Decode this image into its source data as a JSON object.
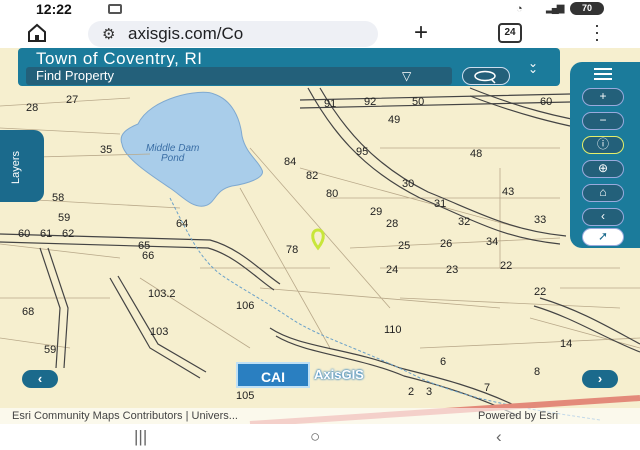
{
  "status_bar": {
    "time": "12:22",
    "battery": "70"
  },
  "browser": {
    "url": "axisgis.com/Co",
    "tab_count": "24"
  },
  "map_header": {
    "title": "Town of Coventry, RI",
    "find_label": "Find Property"
  },
  "layers_label": "Layers",
  "map": {
    "pond_name_1": "Middle Dam",
    "pond_name_2": "Pond",
    "parcels": [
      {
        "id": "p28",
        "t": "28"
      },
      {
        "id": "p27",
        "t": "27"
      },
      {
        "id": "p35",
        "t": "35"
      },
      {
        "id": "p58",
        "t": "58"
      },
      {
        "id": "p59",
        "t": "59"
      },
      {
        "id": "p60",
        "t": "60"
      },
      {
        "id": "p61",
        "t": "61"
      },
      {
        "id": "p62",
        "t": "62"
      },
      {
        "id": "p65",
        "t": "65"
      },
      {
        "id": "p66",
        "t": "66"
      },
      {
        "id": "p64",
        "t": "64"
      },
      {
        "id": "p84",
        "t": "84"
      },
      {
        "id": "p82",
        "t": "82"
      },
      {
        "id": "p80",
        "t": "80"
      },
      {
        "id": "p78",
        "t": "78"
      },
      {
        "id": "p91",
        "t": "91"
      },
      {
        "id": "p92",
        "t": "92"
      },
      {
        "id": "p50",
        "t": "50"
      },
      {
        "id": "p49",
        "t": "49"
      },
      {
        "id": "p95",
        "t": "95"
      },
      {
        "id": "p48",
        "t": "48"
      },
      {
        "id": "p30",
        "t": "30"
      },
      {
        "id": "p43",
        "t": "43"
      },
      {
        "id": "p31",
        "t": "31"
      },
      {
        "id": "p29",
        "t": "29"
      },
      {
        "id": "p28b",
        "t": "28"
      },
      {
        "id": "p32",
        "t": "32"
      },
      {
        "id": "p33",
        "t": "33"
      },
      {
        "id": "p25",
        "t": "25"
      },
      {
        "id": "p26",
        "t": "26"
      },
      {
        "id": "p34",
        "t": "34"
      },
      {
        "id": "p24",
        "t": "24"
      },
      {
        "id": "p23",
        "t": "23"
      },
      {
        "id": "p22",
        "t": "22"
      },
      {
        "id": "p22b",
        "t": "22"
      },
      {
        "id": "p60b",
        "t": "60"
      },
      {
        "id": "p1032",
        "t": "103.2"
      },
      {
        "id": "p106",
        "t": "106"
      },
      {
        "id": "p68",
        "t": "68"
      },
      {
        "id": "p103",
        "t": "103"
      },
      {
        "id": "p110",
        "t": "110"
      },
      {
        "id": "p14",
        "t": "14"
      },
      {
        "id": "p59b",
        "t": "59"
      },
      {
        "id": "p6",
        "t": "6"
      },
      {
        "id": "p8",
        "t": "8"
      },
      {
        "id": "p105",
        "t": "105"
      },
      {
        "id": "p2",
        "t": "2"
      },
      {
        "id": "p3",
        "t": "3"
      },
      {
        "id": "p7",
        "t": "7"
      }
    ]
  },
  "attribution": {
    "left": "Esri Community Maps Contributors | Univers...",
    "right": "Powered by Esri"
  },
  "logo": {
    "cai": "CAI",
    "axis": "AxisGIS"
  },
  "colors": {
    "header": "#1b7b9b",
    "map_bg": "#f6efcf",
    "water": "#a9cdea",
    "pin": "#c8e63a"
  }
}
